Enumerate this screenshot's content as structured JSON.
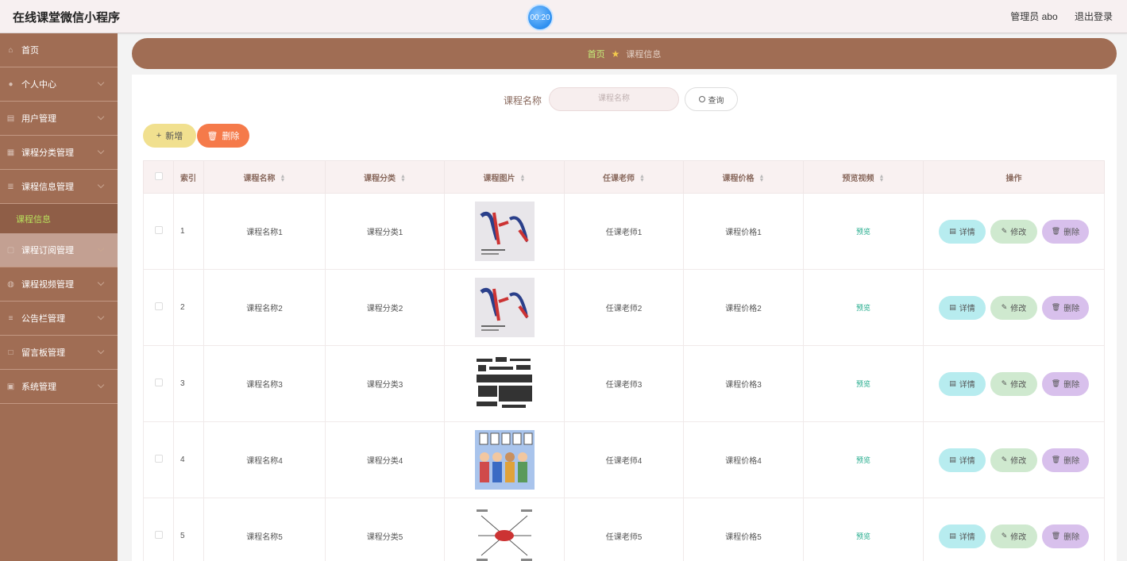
{
  "header": {
    "app_title": "在线课堂微信小程序",
    "clock": "00:20",
    "user": "管理员 abo",
    "logout": "退出登录"
  },
  "sidebar": {
    "items": [
      {
        "label": "首页",
        "icon": "home-icon"
      },
      {
        "label": "个人中心",
        "icon": "user-icon"
      },
      {
        "label": "用户管理",
        "icon": "document-icon"
      },
      {
        "label": "课程分类管理",
        "icon": "grid-icon"
      },
      {
        "label": "课程信息管理",
        "icon": "stack-icon"
      },
      {
        "label": "课程信息",
        "icon": ""
      },
      {
        "label": "课程订阅管理",
        "icon": "frame-icon"
      },
      {
        "label": "课程视频管理",
        "icon": "globe-icon"
      },
      {
        "label": "公告栏管理",
        "icon": "list-icon"
      },
      {
        "label": "留言板管理",
        "icon": "square-icon"
      },
      {
        "label": "系统管理",
        "icon": "settings-icon"
      }
    ]
  },
  "breadcrumb": {
    "home": "首页",
    "current": "课程信息"
  },
  "search": {
    "label": "课程名称",
    "placeholder": "课程名称",
    "button": "查询"
  },
  "toolbar": {
    "add": "新增",
    "delete": "删除"
  },
  "table": {
    "columns": [
      "索引",
      "课程名称",
      "课程分类",
      "课程图片",
      "任课老师",
      "课程价格",
      "预览视频",
      "操作"
    ],
    "rows": [
      {
        "index": "1",
        "name": "课程名称1",
        "category": "课程分类1",
        "image": "calligraphy-poster-image",
        "teacher": "任课老师1",
        "price": "课程价格1",
        "preview": "预览"
      },
      {
        "index": "2",
        "name": "课程名称2",
        "category": "课程分类2",
        "image": "calligraphy-poster-image",
        "teacher": "任课老师2",
        "price": "课程价格2",
        "preview": "预览"
      },
      {
        "index": "3",
        "name": "课程名称3",
        "category": "课程分类3",
        "image": "vocabulary-words-image",
        "teacher": "任课老师3",
        "price": "课程价格3",
        "preview": "预览"
      },
      {
        "index": "4",
        "name": "课程名称4",
        "category": "课程分类4",
        "image": "hello-kids-image",
        "teacher": "任课老师4",
        "price": "课程价格4",
        "preview": "预览"
      },
      {
        "index": "5",
        "name": "课程名称5",
        "category": "课程分类5",
        "image": "have-mindmap-image",
        "teacher": "任课老师5",
        "price": "课程价格5",
        "preview": "预览"
      }
    ],
    "actions": {
      "detail": "详情",
      "edit": "修改",
      "delete": "删除"
    }
  },
  "colors": {
    "sidebar": "#a06d54",
    "accent_add": "#f1e08f",
    "accent_delete": "#f57a4a",
    "preview_link": "#1faa8a"
  }
}
